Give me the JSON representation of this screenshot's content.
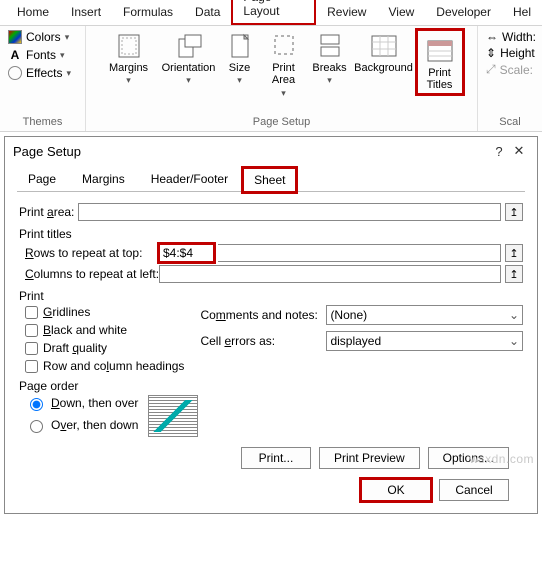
{
  "ribbon": {
    "tabs": [
      "Home",
      "Insert",
      "Formulas",
      "Data",
      "Page Layout",
      "Review",
      "View",
      "Developer",
      "Hel"
    ],
    "themes": {
      "colors": "Colors",
      "fonts": "Fonts",
      "effects": "Effects",
      "label": "Themes"
    },
    "buttons": {
      "margins": "Margins",
      "orientation": "Orientation",
      "size": "Size",
      "printarea": "Print\nArea",
      "breaks": "Breaks",
      "background": "Background",
      "printtitles": "Print\nTitles"
    },
    "page_setup_label": "Page Setup",
    "size": {
      "width": "Width:",
      "height": "Height",
      "scale": "Scale:",
      "label": "Scal"
    }
  },
  "dialog": {
    "title": "Page Setup",
    "tabs": [
      "Page",
      "Margins",
      "Header/Footer",
      "Sheet"
    ],
    "print_area_label": "Print area:",
    "print_titles_label": "Print titles",
    "rows_label": "Rows to repeat at top:",
    "rows_value": "$4:$4",
    "cols_label": "Columns to repeat at left:",
    "print_label": "Print",
    "chk": {
      "gridlines": "Gridlines",
      "bw": "Black and white",
      "draft": "Draft quality",
      "headings": "Row and column headings"
    },
    "comments_label": "Comments and notes:",
    "comments_value": "(None)",
    "errors_label": "Cell errors as:",
    "errors_value": "displayed",
    "order_label": "Page order",
    "order1": "Down, then over",
    "order2": "Over, then down",
    "btn_print": "Print...",
    "btn_preview": "Print Preview",
    "btn_options": "Options...",
    "btn_ok": "OK",
    "btn_cancel": "Cancel"
  },
  "watermark": "wsxdn.com"
}
